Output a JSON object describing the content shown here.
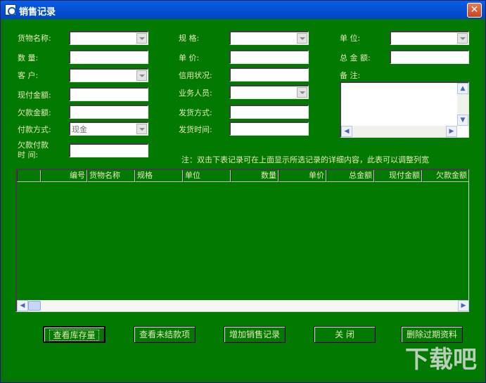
{
  "window": {
    "title": "销售记录",
    "close": "✕"
  },
  "labels": {
    "product_name": "货物名称:",
    "quantity": "数    量:",
    "customer": "客    户:",
    "paid_amount": "现付金额:",
    "owed_amount": "欠款金额:",
    "payment_method": "付款方式:",
    "owed_time_1": "欠款付款",
    "owed_time_2": "时    间:",
    "spec": "规      格:",
    "unit_price": "单      价:",
    "credit": "信用状况:",
    "salesperson": "业务人员:",
    "ship_method": "发货方式:",
    "ship_time": "发货时间:",
    "unit": "单      位:",
    "total": "总 金 额:",
    "remark": "备      注:"
  },
  "values": {
    "payment_method": "现金"
  },
  "note": "注：双击下表记录可在上面显示所选记录的详细内容，此表可以调整列宽",
  "grid": {
    "columns": [
      "",
      "编号",
      "货物名称",
      "规格",
      "单位",
      "数量",
      "单价",
      "总金额",
      "现付金额",
      "欠款金额"
    ]
  },
  "buttons": {
    "view_stock": "查看库存量",
    "view_unsettled": "查看未结款项",
    "add_sale": "增加销售记录",
    "close": "关    闭",
    "delete_expired": "删除过期资料"
  },
  "watermark": "下载吧"
}
